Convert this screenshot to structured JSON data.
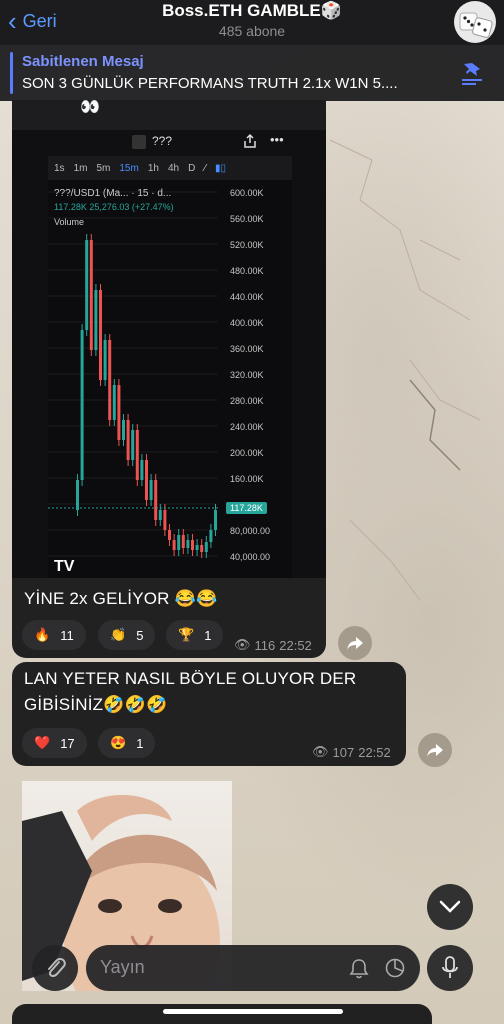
{
  "header": {
    "back_label": "Geri",
    "title": "Boss.ETH GAMBLE🎲",
    "subtitle": "485 abone"
  },
  "pinned": {
    "label": "Sabitlenen Mesaj",
    "text": "SON 3 GÜNLÜK PERFORMANS TRUTH 2.1x W1N 5...."
  },
  "prev_message": {
    "emoji": "👀"
  },
  "chart_screenshot": {
    "pair_header": "???",
    "timeframes": [
      "1s",
      "1m",
      "5m",
      "15m",
      "1h",
      "4h",
      "D"
    ],
    "active_timeframe": "15m",
    "symbol_line": "???/USD1 (Ma... · 15 · d...",
    "price_line": "117.28K  25,276.03 (+27.47%)",
    "volume_label": "Volume",
    "current_price": "117.28K",
    "y_ticks": [
      "600.00K",
      "560.00K",
      "520.00K",
      "480.00K",
      "440.00K",
      "400.00K",
      "360.00K",
      "320.00K",
      "280.00K",
      "240.00K",
      "200.00K",
      "160.00K",
      "80,000.00",
      "40,000.00"
    ]
  },
  "messages": [
    {
      "text": "YİNE 2x GELİYOR 😂😂",
      "reactions": [
        {
          "emoji": "🔥",
          "count": "11"
        },
        {
          "emoji": "👏",
          "count": "5"
        },
        {
          "emoji": "🏆",
          "count": "1"
        }
      ],
      "views": "116",
      "time": "22:52"
    },
    {
      "text_line1": "LAN YETER NASIL BÖYLE OLUYOR DER",
      "text_line2": "GİBİSİNİZ🤣🤣🤣",
      "reactions": [
        {
          "emoji": "❤️",
          "count": "17"
        },
        {
          "emoji": "😍",
          "count": "1"
        }
      ],
      "views": "107",
      "time": "22:52"
    }
  ],
  "composer": {
    "placeholder": "Yayın"
  },
  "colors": {
    "accent": "#5a9bff",
    "bubble": "#212121",
    "pinned_accent": "#7c93ff",
    "up": "#26a69a",
    "down": "#ef5350"
  }
}
